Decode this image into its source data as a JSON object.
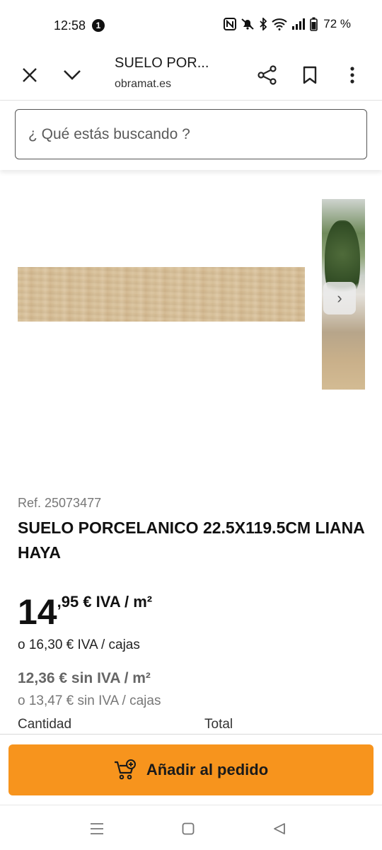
{
  "status": {
    "time": "12:58",
    "notification_count": "1",
    "battery": "72 %"
  },
  "browser": {
    "title": "SUELO POR...",
    "host": "obramat.es"
  },
  "search": {
    "placeholder": "¿ Qué estás buscando ?"
  },
  "gallery": {
    "next_icon": "›"
  },
  "product": {
    "ref": "Ref. 25073477",
    "name": "SUELO PORCELANICO 22.5X119.5CM LIANA HAYA",
    "price_integer": "14",
    "price_decimal_unit": ",95 € IVA / m²",
    "price_box": "o 16,30 € IVA / cajas",
    "price_net": "12,36 € sin IVA / m²",
    "price_net_box": "o 13,47 € sin IVA / cajas",
    "quantity_label": "Cantidad",
    "total_label": "Total"
  },
  "cta": {
    "add_label": "Añadir al pedido"
  },
  "colors": {
    "accent": "#f7941d"
  }
}
